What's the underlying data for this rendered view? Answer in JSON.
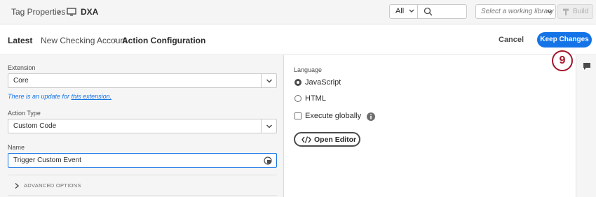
{
  "topbar": {
    "breadcrumb_root": "Tag Properties",
    "breadcrumb_sep": "›",
    "property_icon": "monitor-icon",
    "property_name": "DXA",
    "filter_value": "All",
    "library_placeholder": "Select a working library",
    "build_label": "Build"
  },
  "subheader": {
    "latest": "Latest",
    "account": "New Checking Account",
    "sep": "›",
    "current": "Action Configuration",
    "cancel_label": "Cancel",
    "keep_label": "Keep Changes"
  },
  "step_badge": "9",
  "form": {
    "extension_label": "Extension",
    "extension_value": "Core",
    "update_prefix": "There is an update for ",
    "update_link": "this extension.",
    "action_type_label": "Action Type",
    "action_type_value": "Custom Code",
    "name_label": "Name",
    "name_value": "Trigger Custom Event",
    "advanced_label": "ADVANCED OPTIONS"
  },
  "code_settings": {
    "language_label": "Language",
    "options": [
      "JavaScript",
      "HTML"
    ],
    "selected": "JavaScript",
    "execute_globally_label": "Execute globally",
    "execute_globally_checked": false,
    "open_editor_label": "Open Editor"
  },
  "colors": {
    "accent": "#1473e6",
    "badge": "#a3142b"
  }
}
